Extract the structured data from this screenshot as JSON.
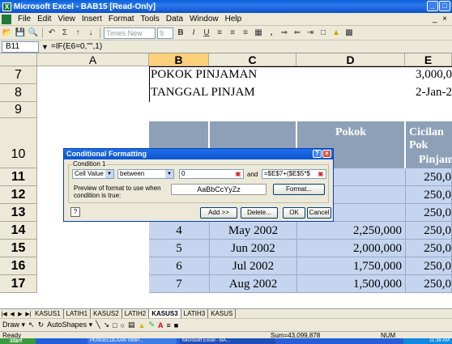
{
  "window": {
    "title": "Microsoft Excel - BAB15 [Read-Only]",
    "controls": [
      "_",
      "□",
      "×"
    ]
  },
  "menu": {
    "items": [
      "File",
      "Edit",
      "View",
      "Insert",
      "Format",
      "Tools",
      "Data",
      "Window",
      "Help"
    ],
    "mdi_controls": "_ ×"
  },
  "toolbar": {
    "font_name": "Times New Roman",
    "font_size": "9",
    "comma_label": ","
  },
  "formula_bar": {
    "name_box": "B11",
    "formula": "=IF(E6=0,\"\",1)"
  },
  "columns": [
    "A",
    "B",
    "C",
    "D",
    "E"
  ],
  "rows": [
    "7",
    "8",
    "9",
    "10",
    "11",
    "12",
    "13",
    "14",
    "15",
    "16",
    "17"
  ],
  "sheet": {
    "pokok_label": "POKOK PINJAMAN",
    "pokok_value": "3,000,0",
    "tanggal_label": "TANGGAL PINJAM",
    "tanggal_value": "2-Jan-2",
    "header_pokok": "Pokok",
    "header_cicilan": "Cicilan Pok",
    "header_pinjaman": "Pinjaman",
    "data_rows": [
      {
        "no": "",
        "date": "",
        "pokok": "",
        "cicilan": "250,0"
      },
      {
        "no": "",
        "date": "",
        "pokok": "",
        "cicilan": "250,0"
      },
      {
        "no": "",
        "date": "",
        "pokok": "",
        "cicilan": "250,0"
      },
      {
        "no": "4",
        "date": "May 2002",
        "pokok": "2,250,000",
        "cicilan": "250,0"
      },
      {
        "no": "5",
        "date": "Jun 2002",
        "pokok": "2,000,000",
        "cicilan": "250,0"
      },
      {
        "no": "6",
        "date": "Jul 2002",
        "pokok": "1,750,000",
        "cicilan": "250,0"
      },
      {
        "no": "7",
        "date": "Aug 2002",
        "pokok": "1,500,000",
        "cicilan": "250,0"
      }
    ]
  },
  "dialog": {
    "title": "Conditional Formatting",
    "title_controls": [
      "?",
      "×"
    ],
    "group_label": "Condition 1",
    "cond_type": "Cell Value Is",
    "operator": "between",
    "value1": "0",
    "and_label": "and",
    "value2": "=$E$7+($E$5*$",
    "preview_label": "Preview of format to use when condition is true:",
    "preview_text": "AaBbCcYyZz",
    "format_button": "Format...",
    "add_button": "Add >>",
    "delete_button": "Delete...",
    "ok_button": "OK",
    "cancel_button": "Cancel"
  },
  "tabs": [
    "KASUS1",
    "LATIH1",
    "KASUS2",
    "LATIH2",
    "KASUS3",
    "LATIH3",
    "KASUS"
  ],
  "active_tab": "KASUS3",
  "draw_toolbar": {
    "draw": "Draw ▾",
    "autoshapes": "AutoShapes ▾"
  },
  "status": {
    "ready": "Ready",
    "sum": "Sum=43,099,878",
    "num": "NUM"
  },
  "taskbar": {
    "start": "start",
    "task1": "PENGELOLAAN SIMP...",
    "task2": "Microsoft Excel - BA...",
    "time": "11:38 AM"
  }
}
